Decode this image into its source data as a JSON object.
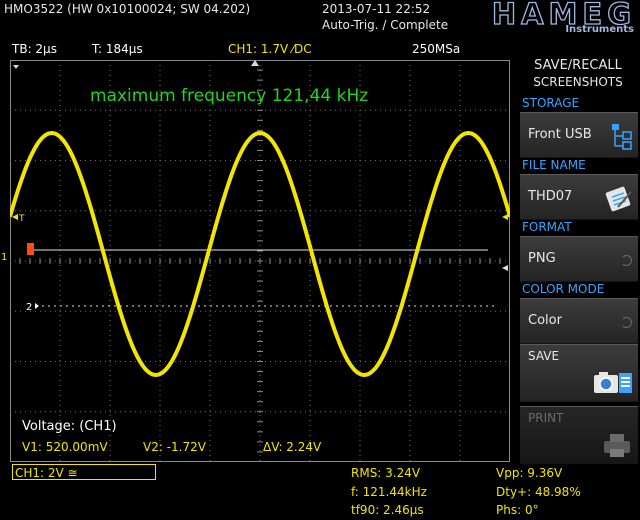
{
  "header": {
    "model": "HMO3522 (HW 0x10100024; SW 04.202)",
    "datetime": "2013-07-11 22:52",
    "trigger_status": "Auto-Trig. / Complete",
    "brand": "HAMEG",
    "brand_sub": "Instruments"
  },
  "info_row": {
    "timebase": "TB: 2µs",
    "trigger_delay": "T: 184µs",
    "channel_setting": "CH1: 1.7V ⁄DC",
    "sample_rate": "250MSa"
  },
  "screen": {
    "annotation": "maximum frequency 121,44 kHz",
    "trigger_marker": "T",
    "ch1_marker": "1",
    "ch2_marker": "2",
    "cursor_title": "Voltage: (CH1)",
    "v1": "V1: 520.00mV",
    "v2": "V2: -1.72V",
    "dv": "ΔV: 2.24V"
  },
  "bottom": {
    "ch1_scale": "CH1: 2V ≅",
    "rms": "RMS: 3.24V",
    "frequency": "f: 121.44kHz",
    "fall_time": "tf90: 2.46µs",
    "vpp": "Vpp: 9.36V",
    "duty": "Dty+: 48.98%",
    "phase": "Phs: 0°"
  },
  "side_menu": {
    "title_line1": "SAVE/RECALL",
    "title_line2": "SCREENSHOTS",
    "storage_label": "STORAGE",
    "storage_value": "Front USB",
    "file_name_label": "FILE NAME",
    "file_name_value": "THD07",
    "format_label": "FORMAT",
    "format_value": "PNG",
    "color_mode_label": "COLOR MODE",
    "color_mode_value": "Color",
    "save_label": "SAVE",
    "print_label": "PRINT"
  },
  "colors": {
    "trace": "#f2e500",
    "annotation": "#22d422",
    "menu_section": "#3aa3ff",
    "trigger_marker": "#ff4b14"
  },
  "waveform": {
    "cycles_on_screen": 2.4,
    "phase_start": 0.05
  }
}
